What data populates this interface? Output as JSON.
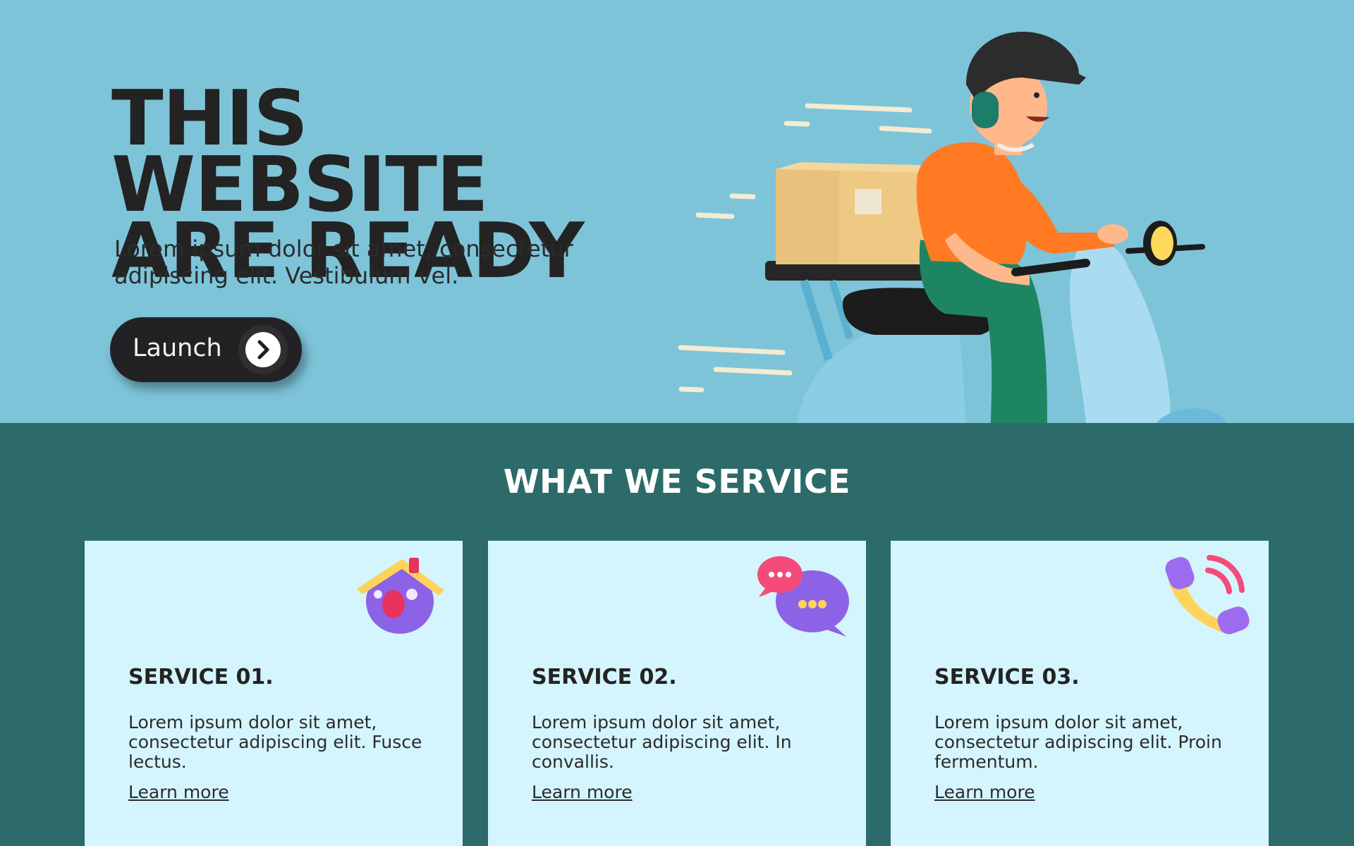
{
  "hero": {
    "title_line1": "THIS WEBSITE",
    "title_line2": "ARE READY",
    "subtitle": "Lorem ipsum dolor sit amet, consectetur adipiscing elit. Vestibulum vel.",
    "launch_label": "Launch",
    "illustration_icon": "delivery-scooter-rider-icon"
  },
  "services": {
    "title": "WHAT WE SERVICE",
    "cards": [
      {
        "heading": "SERVICE 01.",
        "body": "Lorem ipsum dolor sit amet, consectetur adipiscing elit. Fusce lectus.",
        "link": "Learn more",
        "icon": "home-icon"
      },
      {
        "heading": "SERVICE 02.",
        "body": "Lorem ipsum dolor sit amet, consectetur adipiscing elit. In convallis.",
        "link": "Learn more",
        "icon": "chat-bubbles-icon"
      },
      {
        "heading": "SERVICE 03.",
        "body": "Lorem ipsum dolor sit amet, consectetur adipiscing elit. Proin fermentum.",
        "link": "Learn more",
        "icon": "phone-call-icon"
      }
    ]
  },
  "colors": {
    "hero_bg": "#7dc4d9",
    "services_bg": "#2c6b69",
    "card_bg": "#d4f5fd",
    "text_dark": "#232323",
    "button_bg": "#222224"
  }
}
